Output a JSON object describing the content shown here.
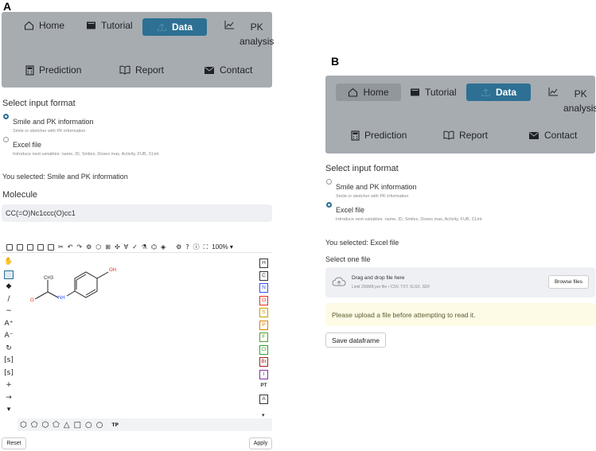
{
  "panel_a": {
    "label": "A",
    "nav": {
      "home": "Home",
      "tutorial": "Tutorial",
      "data": "Data",
      "pk_line1": "PK",
      "pk_line2": "analysis",
      "prediction": "Prediction",
      "report": "Report",
      "contact": "Contact"
    },
    "select_format_title": "Select input format",
    "options": [
      {
        "label": "Smile and PK information",
        "sub": "Smile or sketcher with PK information",
        "selected": true
      },
      {
        "label": "Excel file",
        "sub": "Introduce next variables: name, ID, Smiles, Doses max, Activity, FUB, CLint",
        "selected": false
      }
    ],
    "you_selected": "You selected: Smile and PK information",
    "molecule_title": "Molecule",
    "smiles_value": "CC(=O)Nc1ccc(O)cc1",
    "zoom": "100%",
    "structure_labels": {
      "ch3": "CH3",
      "oh": "OH",
      "o": "O",
      "nh": "NH"
    },
    "elements": [
      "H",
      "C",
      "N",
      "O",
      "S",
      "P",
      "F",
      "Cl",
      "Br",
      "I",
      "PT",
      "A"
    ],
    "element_colors": {
      "H": "#333333",
      "C": "#333333",
      "N": "#3050f8",
      "O": "#e0301e",
      "S": "#c8a000",
      "P": "#e08000",
      "F": "#50a030",
      "Cl": "#30a030",
      "Br": "#a02020",
      "I": "#8030a0",
      "PT": "#333333",
      "A": "#333333"
    },
    "left_tools": [
      "✋",
      "⬚",
      "◆",
      "∕",
      "∼",
      "A⁺",
      "A⁻",
      "↻",
      "[s]",
      "[s]",
      "+",
      "→",
      "▾"
    ],
    "reset": "Reset",
    "apply": "Apply"
  },
  "panel_b": {
    "label": "B",
    "nav": {
      "home": "Home",
      "tutorial": "Tutorial",
      "data": "Data",
      "pk_line1": "PK",
      "pk_line2": "analysis",
      "prediction": "Prediction",
      "report": "Report",
      "contact": "Contact"
    },
    "select_format_title": "Select input format",
    "options": [
      {
        "label": "Smile and PK information",
        "sub": "Smile or sketcher with PK information",
        "selected": false
      },
      {
        "label": "Excel file",
        "sub": "Introduce next variables: name, ID, Smiles, Doses max, Activity, FUB, CLint",
        "selected": true
      }
    ],
    "you_selected": "You selected: Excel file",
    "select_file_title": "Select one file",
    "drop_title": "Drag and drop file here",
    "drop_sub": "Limit 200MB per file • CSV, TXT, XLSX, SDF",
    "browse": "Browse files",
    "warning": "Please upload a file before attempting to read it.",
    "save": "Save dataframe"
  },
  "colors": {
    "nav_bg": "#a7acb1",
    "active": "#2d7093",
    "radio": "#2d7093",
    "warn_bg": "#fdfbe6"
  }
}
